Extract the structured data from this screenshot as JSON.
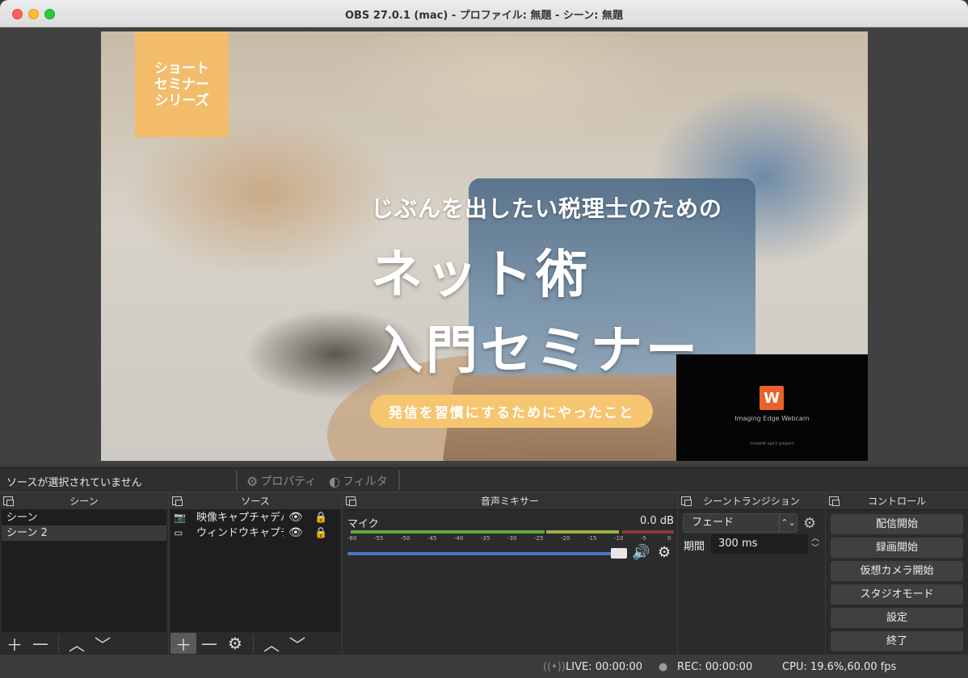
{
  "window": {
    "title": "OBS 27.0.1 (mac) - プロファイル: 無題 - シーン: 無題"
  },
  "preview": {
    "badge_text": "ショート\nセミナー\nシリーズ",
    "subtitle": "じぶんを出したい税理士のための",
    "title_line1": "ネット術",
    "title_line2": "入門セミナー",
    "pill": "発信を習慣にするためにやったこと",
    "webcam_logo": "W",
    "webcam_name": "Imaging Edge Webcam",
    "webcam_small": "model# apk3 gregom"
  },
  "source_toolbar": {
    "no_selection": "ソースが選択されていません",
    "properties": "プロパティ",
    "filters": "フィルタ"
  },
  "scenes": {
    "title": "シーン",
    "items": [
      {
        "label": "シーン",
        "selected": false
      },
      {
        "label": "シーン 2",
        "selected": true
      }
    ]
  },
  "sources": {
    "title": "ソース",
    "items": [
      {
        "label": "映像キャプチャデバイス",
        "icon": "camera-icon"
      },
      {
        "label": "ウィンドウキャプチャ",
        "icon": "window-icon"
      }
    ]
  },
  "mixer": {
    "title": "音声ミキサー",
    "channel": "マイク",
    "db": "0.0 dB",
    "ticks": [
      "-60",
      "-55",
      "-50",
      "-45",
      "-40",
      "-35",
      "-30",
      "-25",
      "-20",
      "-15",
      "-10",
      "-5",
      "0"
    ],
    "volume": 1.0
  },
  "transitions": {
    "title": "シーントランジション",
    "selected": "フェード",
    "duration_label": "期間",
    "duration": "300 ms"
  },
  "controls": {
    "title": "コントロール",
    "buttons": [
      "配信開始",
      "録画開始",
      "仮想カメラ開始",
      "スタジオモード",
      "設定",
      "終了"
    ]
  },
  "status": {
    "live": "LIVE: 00:00:00",
    "rec": "REC: 00:00:00",
    "cpu": "CPU: 19.6%,60.00 fps"
  }
}
